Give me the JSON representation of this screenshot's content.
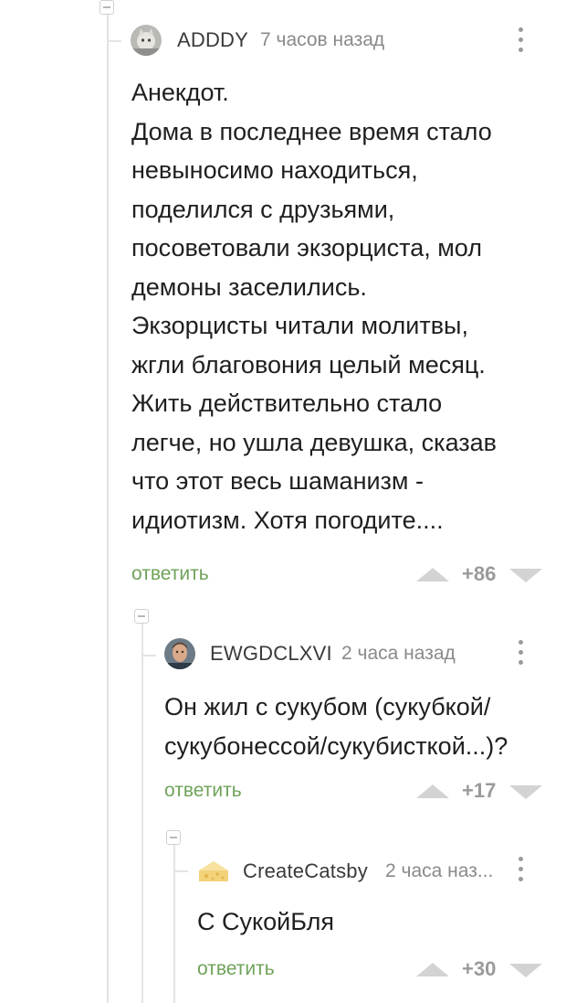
{
  "comments": [
    {
      "author": "ADDDY",
      "time": "7 часов назад",
      "text": "Анекдот.\nДома в последнее время стало\nневыносимо находиться,\nподелился с друзьями,\nпосоветовали экзорциста, мол\nдемоны заселились.\nЭкзорцисты читали молитвы,\nжгли благовония целый месяц.\nЖить действительно стало\nлегче, но ушла девушка, сказав\nчто этот весь шаманизм -\nидиотизм. Хотя погодите....",
      "reply_label": "ответить",
      "score": "+86",
      "avatar_icon": "cat-photo-avatar"
    },
    {
      "author": "EWGDCLXVI",
      "time": "2 часа назад",
      "text": "Он жил с сукубом (сукубкой/\nсукубонессой/сукубисткой...)?",
      "reply_label": "ответить",
      "score": "+17",
      "avatar_icon": "man-photo-avatar"
    },
    {
      "author": "CreateCatsby",
      "time": "2 часа наз...",
      "text": "С СукойБля",
      "reply_label": "ответить",
      "score": "+30",
      "avatar_icon": "cheese-avatar"
    }
  ],
  "colors": {
    "reply_link": "#6fa35a",
    "vote_arrow": "#d3d3d3",
    "thread_line": "#e4e4e4"
  }
}
